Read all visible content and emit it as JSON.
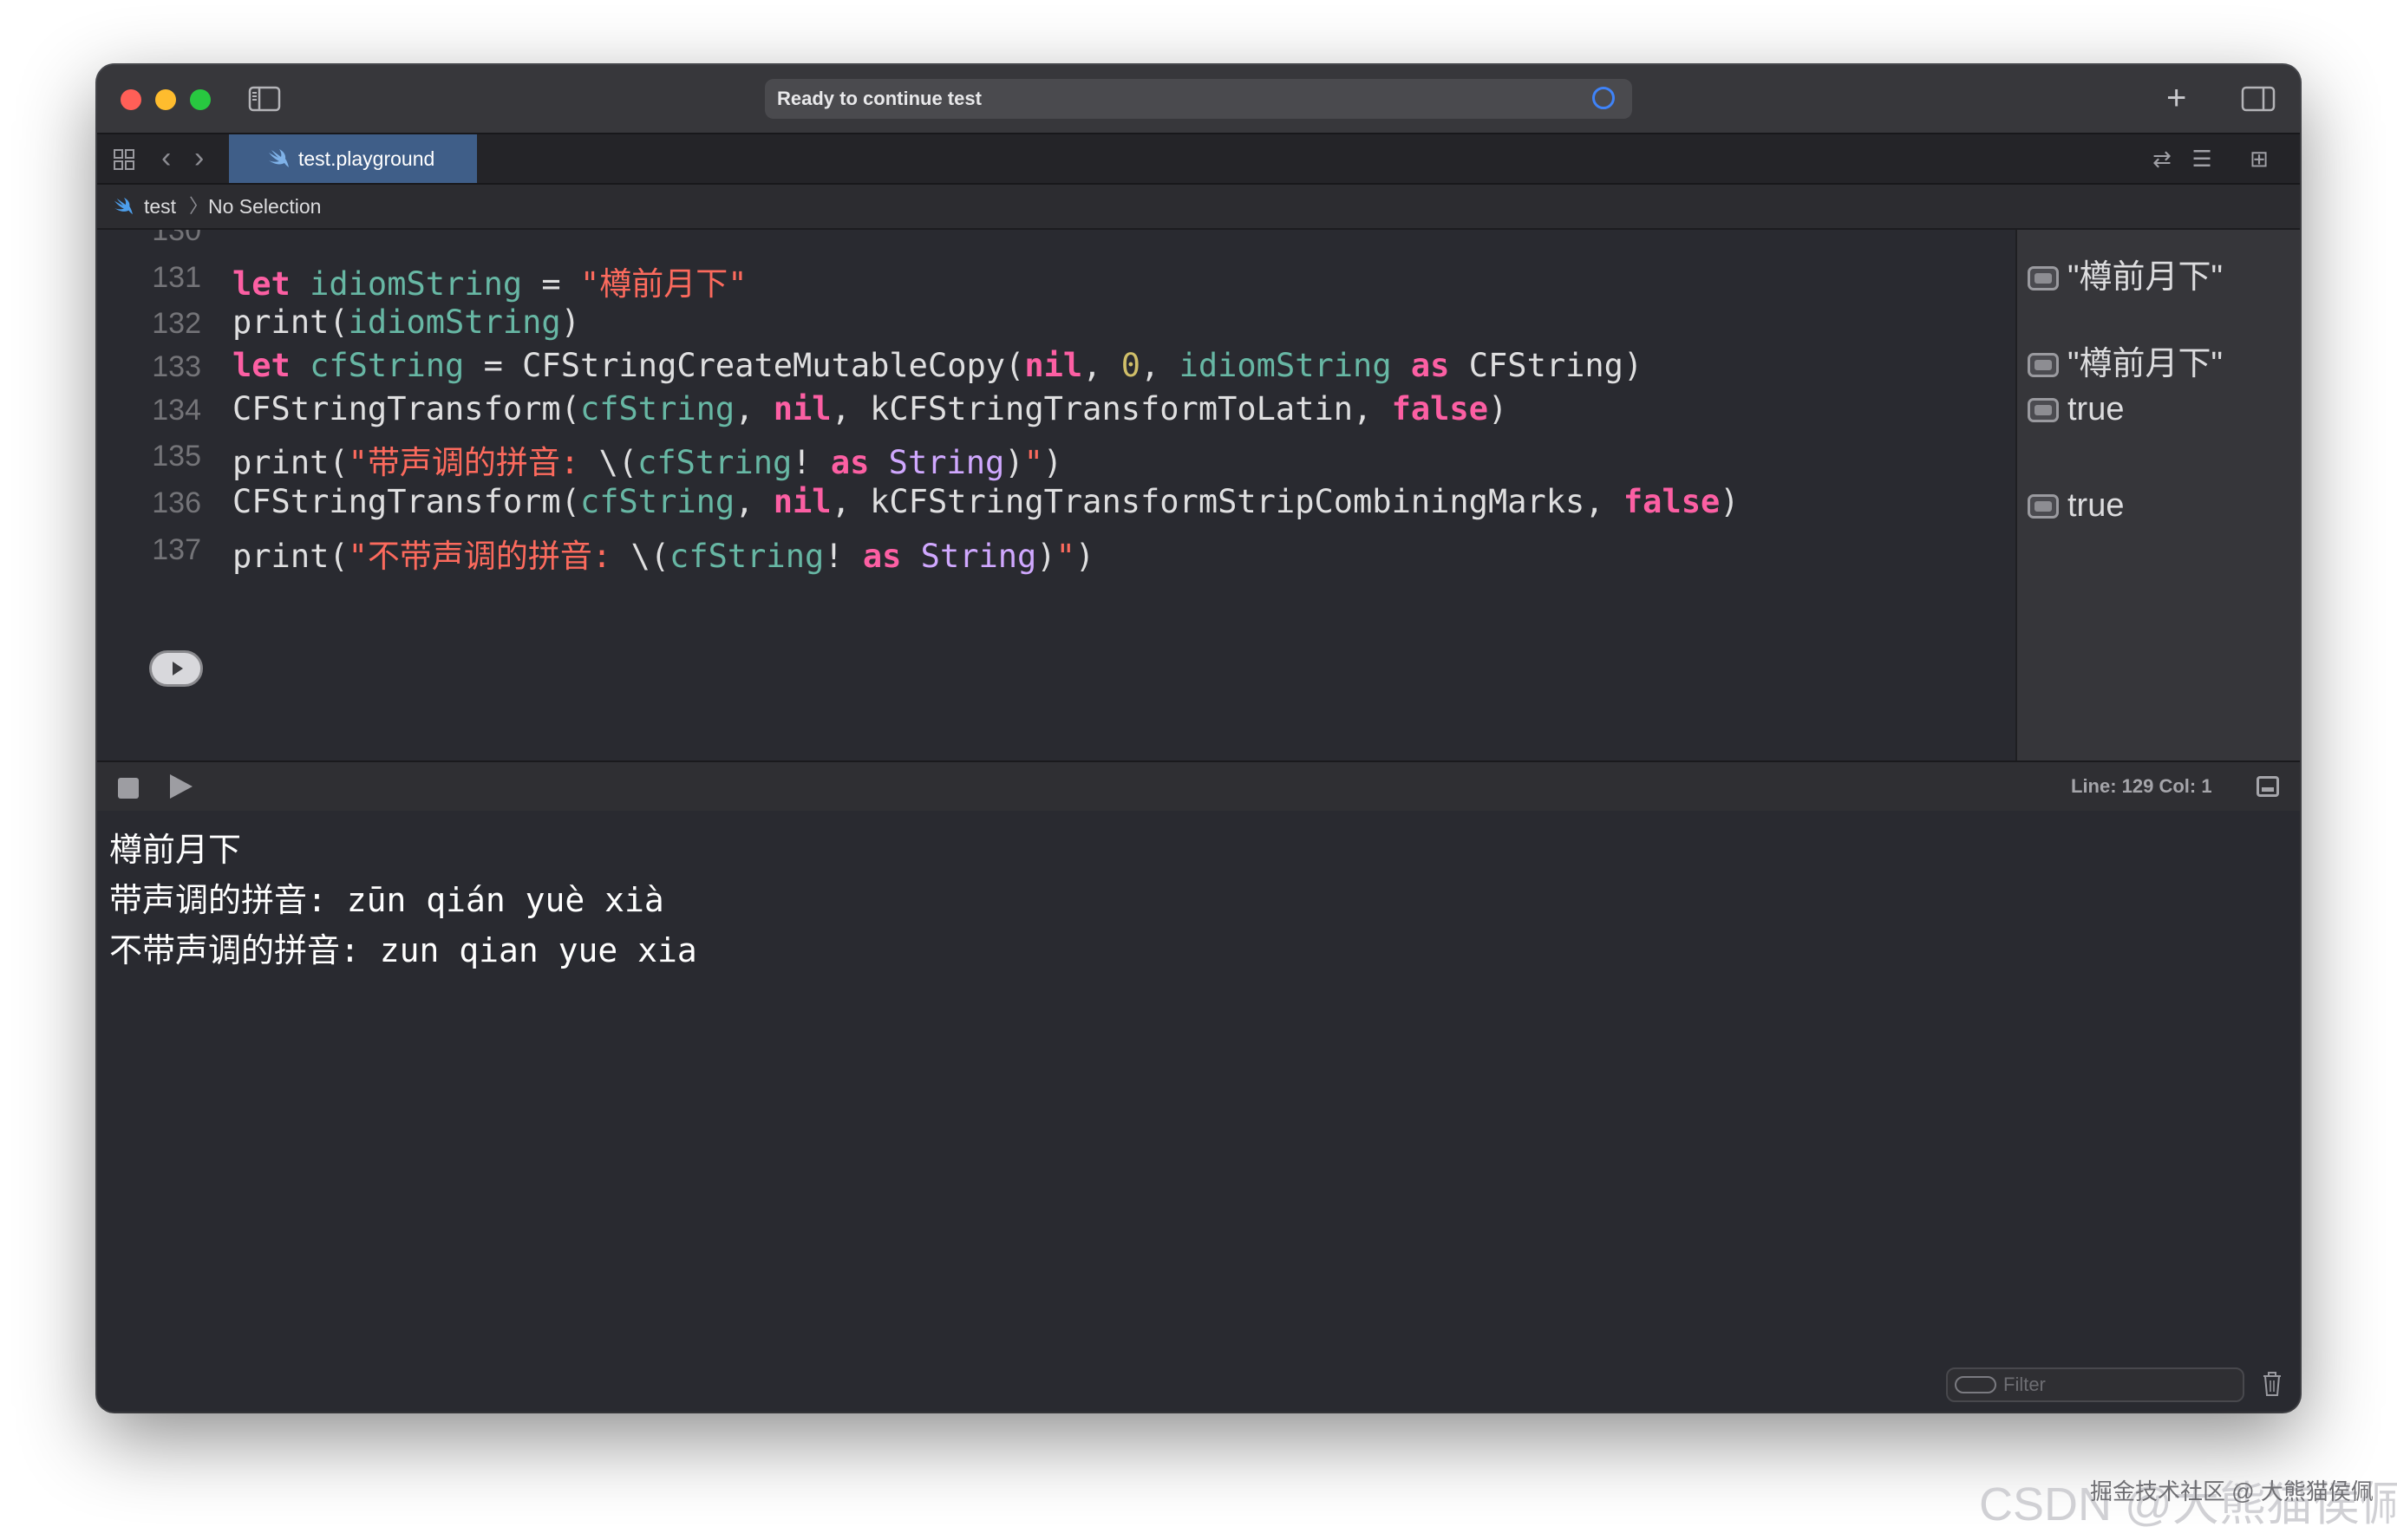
{
  "titlebar": {
    "activity_text": "Ready to continue test"
  },
  "tabs": [
    {
      "label": "test.playground",
      "active": true
    }
  ],
  "breadcrumb": {
    "project": "test",
    "separator": "〉",
    "selection": "No Selection"
  },
  "editor": {
    "partial_line_number": "130",
    "lines": [
      {
        "number": "131",
        "tokens": [
          {
            "t": "let",
            "c": "kw"
          },
          {
            "t": " ",
            "c": "plain"
          },
          {
            "t": "idiomString",
            "c": "var"
          },
          {
            "t": " = ",
            "c": "plain"
          },
          {
            "t": "\"樽前月下\"",
            "c": "str"
          }
        ]
      },
      {
        "number": "132",
        "tokens": [
          {
            "t": "print(",
            "c": "plain"
          },
          {
            "t": "idiomString",
            "c": "var"
          },
          {
            "t": ")",
            "c": "plain"
          }
        ]
      },
      {
        "number": "133",
        "tokens": [
          {
            "t": "let",
            "c": "kw"
          },
          {
            "t": " ",
            "c": "plain"
          },
          {
            "t": "cfString",
            "c": "var"
          },
          {
            "t": " = CFStringCreateMutableCopy(",
            "c": "plain"
          },
          {
            "t": "nil",
            "c": "kw"
          },
          {
            "t": ", ",
            "c": "plain"
          },
          {
            "t": "0",
            "c": "num"
          },
          {
            "t": ", ",
            "c": "plain"
          },
          {
            "t": "idiomString",
            "c": "var"
          },
          {
            "t": " ",
            "c": "plain"
          },
          {
            "t": "as",
            "c": "kw"
          },
          {
            "t": " CFString)",
            "c": "plain"
          }
        ]
      },
      {
        "number": "134",
        "tokens": [
          {
            "t": "CFStringTransform(",
            "c": "plain"
          },
          {
            "t": "cfString",
            "c": "var"
          },
          {
            "t": ", ",
            "c": "plain"
          },
          {
            "t": "nil",
            "c": "kw"
          },
          {
            "t": ", kCFStringTransformToLatin, ",
            "c": "plain"
          },
          {
            "t": "false",
            "c": "kw"
          },
          {
            "t": ")",
            "c": "plain"
          }
        ]
      },
      {
        "number": "135",
        "tokens": [
          {
            "t": "print(",
            "c": "plain"
          },
          {
            "t": "\"带声调的拼音: ",
            "c": "str"
          },
          {
            "t": "\\(",
            "c": "plain"
          },
          {
            "t": "cfString",
            "c": "var"
          },
          {
            "t": "! ",
            "c": "plain"
          },
          {
            "t": "as",
            "c": "kw"
          },
          {
            "t": " ",
            "c": "plain"
          },
          {
            "t": "String",
            "c": "typ"
          },
          {
            "t": ")",
            "c": "plain"
          },
          {
            "t": "\"",
            "c": "str"
          },
          {
            "t": ")",
            "c": "plain"
          }
        ]
      },
      {
        "number": "136",
        "tokens": [
          {
            "t": "CFStringTransform(",
            "c": "plain"
          },
          {
            "t": "cfString",
            "c": "var"
          },
          {
            "t": ", ",
            "c": "plain"
          },
          {
            "t": "nil",
            "c": "kw"
          },
          {
            "t": ", kCFStringTransformStripCombiningMarks, ",
            "c": "plain"
          },
          {
            "t": "false",
            "c": "kw"
          },
          {
            "t": ")",
            "c": "plain"
          }
        ]
      },
      {
        "number": "137",
        "tokens": [
          {
            "t": "print(",
            "c": "plain"
          },
          {
            "t": "\"不带声调的拼音: ",
            "c": "str"
          },
          {
            "t": "\\(",
            "c": "plain"
          },
          {
            "t": "cfString",
            "c": "var"
          },
          {
            "t": "! ",
            "c": "plain"
          },
          {
            "t": "as",
            "c": "kw"
          },
          {
            "t": " ",
            "c": "plain"
          },
          {
            "t": "String",
            "c": "typ"
          },
          {
            "t": ")",
            "c": "plain"
          },
          {
            "t": "\"",
            "c": "str"
          },
          {
            "t": ")",
            "c": "plain"
          }
        ]
      }
    ]
  },
  "results": [
    {
      "line": "131",
      "text": "\"樽前月下\""
    },
    {
      "line": "133",
      "text": "\"樽前月下\""
    },
    {
      "line": "134",
      "text": "true"
    },
    {
      "line": "136",
      "text": "true"
    }
  ],
  "debugbar": {
    "position": "Line: 129  Col: 1"
  },
  "console": {
    "lines": [
      "樽前月下",
      "带声调的拼音: zūn qián yuè xià",
      "不带声调的拼音: zun qian yue xia"
    ],
    "filter_placeholder": "Filter"
  },
  "watermark": {
    "big": "CSDN @大熊猫侯佩",
    "small": "掘金技术社区 @ 大熊猫侯佩"
  },
  "colors": {
    "keyword": "#fc5fa3",
    "variable": "#67b7a4",
    "string": "#fc6a5d",
    "number": "#d0bf69",
    "type": "#d0a8ff",
    "active_tab": "#3f5e88",
    "spinner": "#3f83f8"
  },
  "icons": [
    "sidebar-toggle-icon",
    "add-icon",
    "inspector-toggle-icon",
    "grid-icon",
    "chevron-left-icon",
    "chevron-right-icon",
    "swift-icon",
    "swap-icon",
    "adjust-icon",
    "add-editor-icon",
    "quick-look-icon",
    "stop-icon",
    "play-icon",
    "console-toggle-icon",
    "filter-icon",
    "trash-icon",
    "spinner-icon"
  ]
}
